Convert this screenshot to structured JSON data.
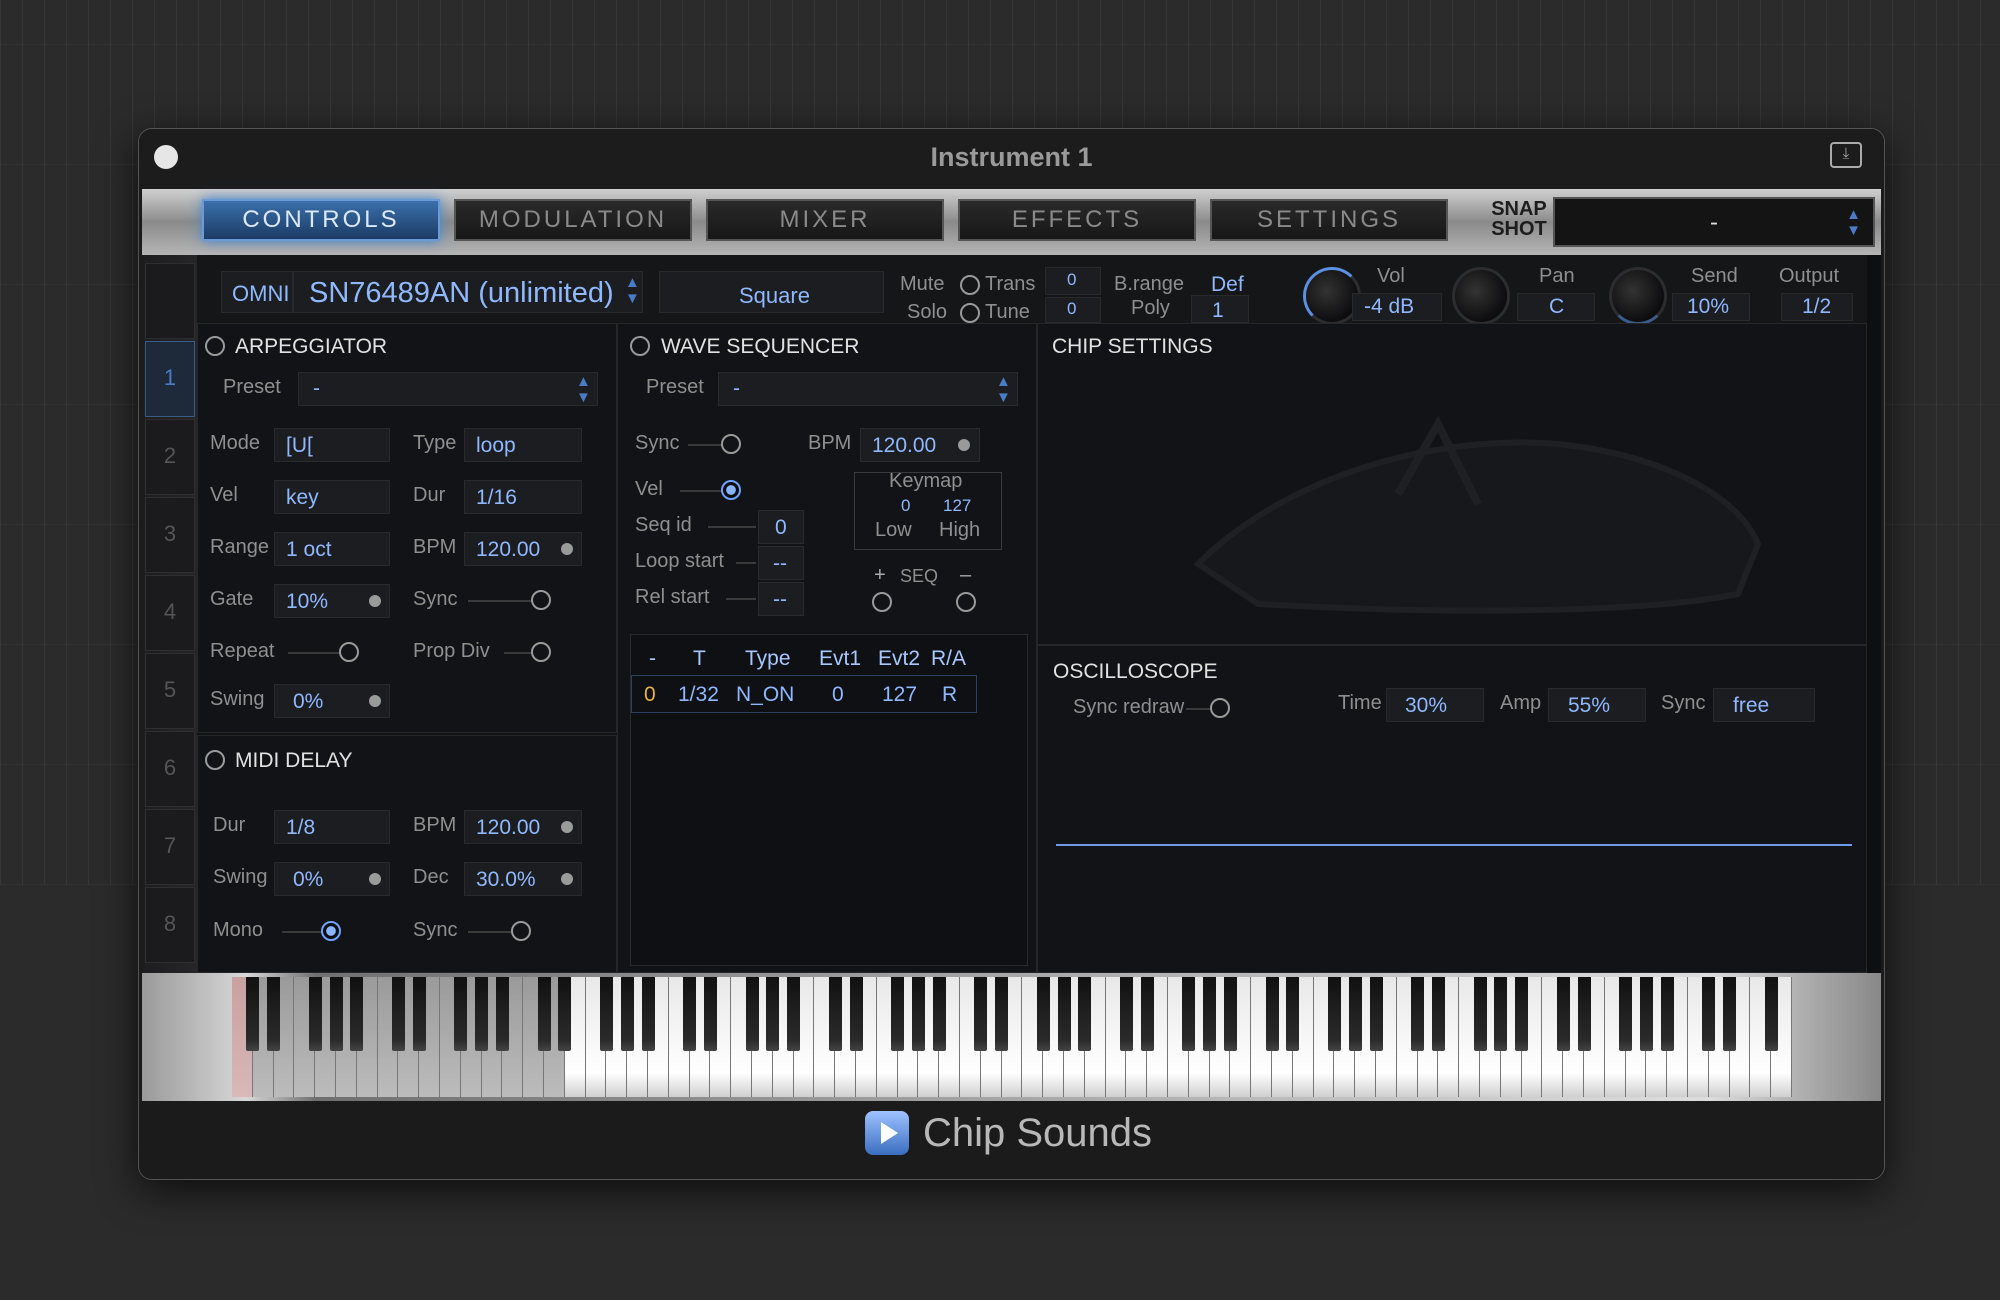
{
  "window": {
    "title": "Instrument 1"
  },
  "tabs": [
    "CONTROLS",
    "MODULATION",
    "MIXER",
    "EFFECTS",
    "SETTINGS"
  ],
  "snapshot": {
    "label_line1": "SNAP",
    "label_line2": "SHOT",
    "value": "-"
  },
  "side_tabs": [
    "1",
    "2",
    "3",
    "4",
    "5",
    "6",
    "7",
    "8"
  ],
  "header": {
    "omni": "OMNI",
    "instrument": "SN76489AN (unlimited)",
    "waveform": "Square",
    "mute_label": "Mute",
    "solo_label": "Solo",
    "trans_label": "Trans",
    "trans_value": "0",
    "tune_label": "Tune",
    "tune_value": "0",
    "brange_label": "B.range",
    "brange_value": "Def",
    "poly_label": "Poly",
    "poly_value": "1",
    "vol_label": "Vol",
    "vol_value": "-4 dB",
    "pan_label": "Pan",
    "pan_value": "C",
    "send_label": "Send",
    "send_value": "10%",
    "output_label": "Output",
    "output_value": "1/2"
  },
  "arpeggiator": {
    "title": "ARPEGGIATOR",
    "preset_label": "Preset",
    "preset_value": "-",
    "mode_label": "Mode",
    "mode_value": "[U[",
    "type_label": "Type",
    "type_value": "loop",
    "vel_label": "Vel",
    "vel_value": "key",
    "dur_label": "Dur",
    "dur_value": "1/16",
    "range_label": "Range",
    "range_value": "1 oct",
    "bpm_label": "BPM",
    "bpm_value": "120.00",
    "gate_label": "Gate",
    "gate_value": "10%",
    "sync_label": "Sync",
    "repeat_label": "Repeat",
    "propdiv_label": "Prop Div",
    "swing_label": "Swing",
    "swing_value": "0%"
  },
  "midi_delay": {
    "title": "MIDI DELAY",
    "dur_label": "Dur",
    "dur_value": "1/8",
    "bpm_label": "BPM",
    "bpm_value": "120.00",
    "swing_label": "Swing",
    "swing_value": "0%",
    "dec_label": "Dec",
    "dec_value": "30.0%",
    "mono_label": "Mono",
    "sync_label": "Sync"
  },
  "wave_sequencer": {
    "title": "WAVE SEQUENCER",
    "preset_label": "Preset",
    "preset_value": "-",
    "sync_label": "Sync",
    "bpm_label": "BPM",
    "bpm_value": "120.00",
    "vel_label": "Vel",
    "seqid_label": "Seq id",
    "seqid_value": "0",
    "loopstart_label": "Loop start",
    "loopstart_value": "--",
    "relstart_label": "Rel start",
    "relstart_value": "--",
    "keymap_label": "Keymap",
    "low_value": "0",
    "high_value": "127",
    "low_label": "Low",
    "high_label": "High",
    "seq_plus": "+",
    "seq_label": "SEQ",
    "seq_minus": "–",
    "table": {
      "headers": [
        "-",
        "T",
        "Type",
        "Evt1",
        "Evt2",
        "R/A"
      ],
      "row": [
        "0",
        "1/32",
        "N_ON",
        "0",
        "127",
        "R"
      ]
    }
  },
  "chip_settings": {
    "title": "CHIP SETTINGS"
  },
  "oscilloscope": {
    "title": "OSCILLOSCOPE",
    "sync_redraw_label": "Sync redraw",
    "time_label": "Time",
    "time_value": "30%",
    "amp_label": "Amp",
    "amp_value": "55%",
    "sync_label": "Sync",
    "sync_value": "free"
  },
  "footer": {
    "title": "Chip Sounds"
  },
  "colors": {
    "accent": "#8fb8ff",
    "active_tab": "#3a6faa",
    "highlight_cell": "#e6b24a"
  }
}
